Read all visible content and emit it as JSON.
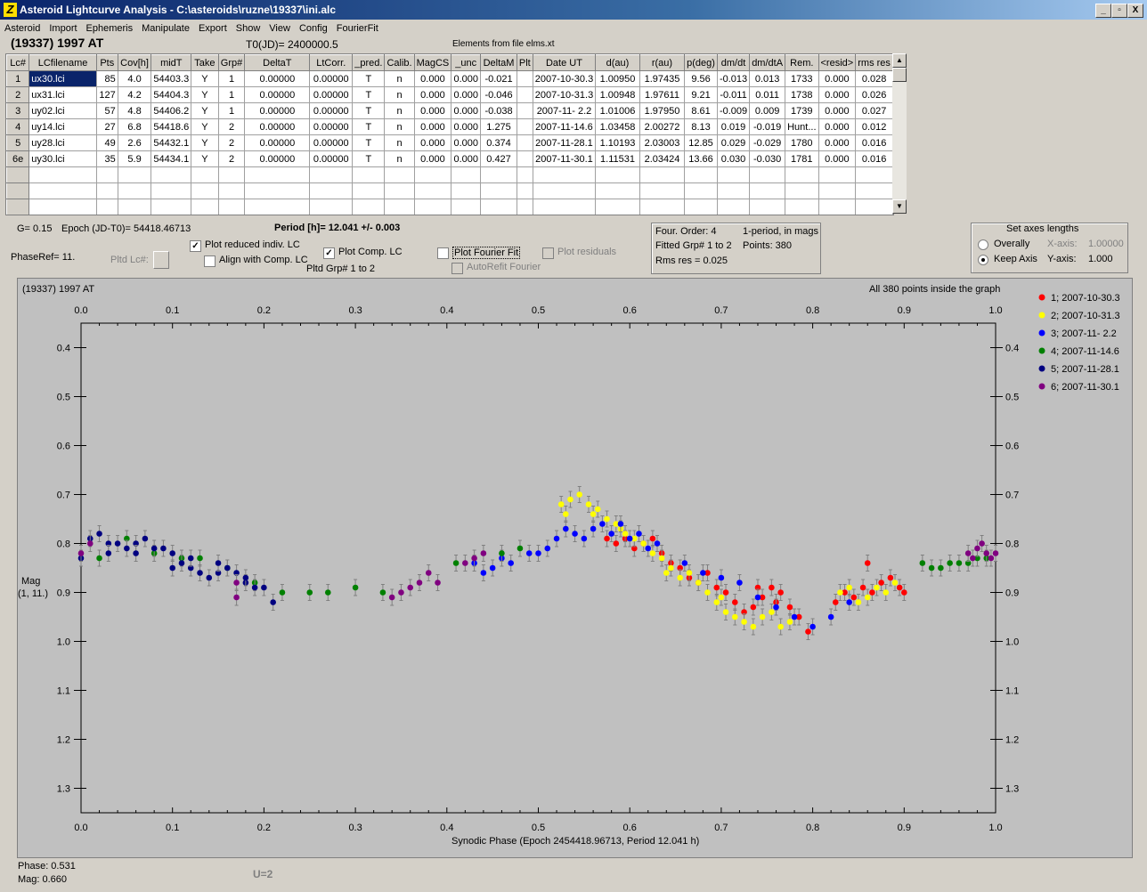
{
  "window": {
    "title": "Asteroid Lightcurve Analysis - C:\\asteroids\\ruzne\\19337\\ini.alc",
    "buttons": [
      "_",
      "▫",
      "X"
    ]
  },
  "menu": [
    "Asteroid",
    "Import",
    "Ephemeris",
    "Manipulate",
    "Export",
    "Show",
    "View",
    "Config",
    "FourierFit"
  ],
  "header": {
    "asteroid": "(19337) 1997 AT",
    "t0": "T0(JD)= 2400000.5",
    "elements": "Elements from file elms.xt"
  },
  "table": {
    "columns": [
      "Lc#",
      "LCfilename",
      "Pts",
      "Cov[h]",
      "midT",
      "Take",
      "Grp#",
      "DeltaT",
      "LtCorr.",
      "_pred.",
      "Calib.",
      "MagCS",
      "_unc",
      "DeltaM",
      "Plt",
      "Date UT",
      "d(au)",
      "r(au)",
      "p(deg)",
      "dm/dt",
      "dm/dtA",
      "Rem.",
      "<resid>",
      "rms res"
    ],
    "rows": [
      [
        "1",
        "ux30.lci",
        "85",
        "4.0",
        "54403.3",
        "Y",
        "1",
        "0.00000",
        "0.00000",
        "T",
        "n",
        "0.000",
        "0.000",
        "-0.021",
        "",
        "2007-10-30.3",
        "1.00950",
        "1.97435",
        "9.56",
        "-0.013",
        "0.013",
        "1733",
        "0.000",
        "0.028"
      ],
      [
        "2",
        "ux31.lci",
        "127",
        "4.2",
        "54404.3",
        "Y",
        "1",
        "0.00000",
        "0.00000",
        "T",
        "n",
        "0.000",
        "0.000",
        "-0.046",
        "",
        "2007-10-31.3",
        "1.00948",
        "1.97611",
        "9.21",
        "-0.011",
        "0.011",
        "1738",
        "0.000",
        "0.026"
      ],
      [
        "3",
        "uy02.lci",
        "57",
        "4.8",
        "54406.2",
        "Y",
        "1",
        "0.00000",
        "0.00000",
        "T",
        "n",
        "0.000",
        "0.000",
        "-0.038",
        "",
        "2007-11- 2.2",
        "1.01006",
        "1.97950",
        "8.61",
        "-0.009",
        "0.009",
        "1739",
        "0.000",
        "0.027"
      ],
      [
        "4",
        "uy14.lci",
        "27",
        "6.8",
        "54418.6",
        "Y",
        "2",
        "0.00000",
        "0.00000",
        "T",
        "n",
        "0.000",
        "0.000",
        "1.275",
        "",
        "2007-11-14.6",
        "1.03458",
        "2.00272",
        "8.13",
        "0.019",
        "-0.019",
        "Hunt...",
        "0.000",
        "0.012"
      ],
      [
        "5",
        "uy28.lci",
        "49",
        "2.6",
        "54432.1",
        "Y",
        "2",
        "0.00000",
        "0.00000",
        "T",
        "n",
        "0.000",
        "0.000",
        "0.374",
        "",
        "2007-11-28.1",
        "1.10193",
        "2.03003",
        "12.85",
        "0.029",
        "-0.029",
        "1780",
        "0.000",
        "0.016"
      ],
      [
        "6e",
        "uy30.lci",
        "35",
        "5.9",
        "54434.1",
        "Y",
        "2",
        "0.00000",
        "0.00000",
        "T",
        "n",
        "0.000",
        "0.000",
        "0.427",
        "",
        "2007-11-30.1",
        "1.11531",
        "2.03424",
        "13.66",
        "0.030",
        "-0.030",
        "1781",
        "0.000",
        "0.016"
      ]
    ],
    "empty_rows": 3
  },
  "params": {
    "g": "G= 0.15",
    "epoch": "Epoch (JD-T0)= 54418.46713",
    "period": "Period [h]= 12.041 +/- 0.003",
    "phaseref": "PhaseRef= 11.",
    "pltd_lc": "Pltd Lc#:",
    "plot_reduced": "Plot reduced indiv. LC",
    "align_comp": "Align with Comp. LC",
    "plot_comp": "Plot Comp. LC",
    "pltd_grp": "Pltd Grp#  1   to   2",
    "plot_fourier": "Plot Fourier Fit",
    "autorefit": "AutoRefit Fourier",
    "plot_residuals": "Plot residuals"
  },
  "fourier_info": {
    "order": "Four. Order:  4",
    "mode": "1-period, in mags",
    "fitted": "Fitted Grp# 1 to 2",
    "points": "Points: 380",
    "rms": "Rms res     = 0.025"
  },
  "axes_box": {
    "title": "Set axes lengths",
    "overally": "Overally",
    "keep_axis": "Keep Axis",
    "xaxis_label": "X-axis:",
    "xaxis_value": "1.00000",
    "yaxis_label": "Y-axis:",
    "yaxis_value": "1.000"
  },
  "graph": {
    "top_left": "(19337) 1997 AT",
    "top_right": "All 380 points inside the graph",
    "ylabel_line1": "Mag",
    "ylabel_line2": "(1, 11.)",
    "xlabel": "Synodic Phase (Epoch 2454418.96713, Period 12.041 h)"
  },
  "status": {
    "phase": "Phase:  0.531",
    "mag": "Mag:    0.660",
    "u": "U=2"
  },
  "chart_data": {
    "type": "scatter",
    "xlabel": "Synodic Phase (Epoch 2454418.96713, Period 12.041 h)",
    "ylabel": "Mag (1, 11.)",
    "xlim": [
      0,
      1
    ],
    "ylim": [
      1.35,
      0.35
    ],
    "y_inverted": true,
    "xticks": [
      "0.0",
      "0.1",
      "0.2",
      "0.3",
      "0.4",
      "0.5",
      "0.6",
      "0.7",
      "0.8",
      "0.9",
      "1.0"
    ],
    "yticks": [
      "0.4",
      "0.5",
      "0.6",
      "0.7",
      "0.8",
      "0.9",
      "1.0",
      "1.1",
      "1.2",
      "1.3"
    ],
    "legend_position": "right",
    "series": [
      {
        "name": "1; 2007-10-30.3",
        "color": "#ff0000",
        "points": [
          [
            0.575,
            0.79
          ],
          [
            0.585,
            0.8
          ],
          [
            0.595,
            0.79
          ],
          [
            0.605,
            0.81
          ],
          [
            0.615,
            0.8
          ],
          [
            0.625,
            0.79
          ],
          [
            0.635,
            0.82
          ],
          [
            0.645,
            0.84
          ],
          [
            0.655,
            0.85
          ],
          [
            0.665,
            0.87
          ],
          [
            0.675,
            0.88
          ],
          [
            0.685,
            0.86
          ],
          [
            0.695,
            0.89
          ],
          [
            0.705,
            0.9
          ],
          [
            0.715,
            0.92
          ],
          [
            0.725,
            0.94
          ],
          [
            0.735,
            0.93
          ],
          [
            0.745,
            0.91
          ],
          [
            0.755,
            0.89
          ],
          [
            0.765,
            0.9
          ],
          [
            0.775,
            0.93
          ],
          [
            0.785,
            0.95
          ],
          [
            0.795,
            0.98
          ],
          [
            0.825,
            0.92
          ],
          [
            0.835,
            0.9
          ],
          [
            0.845,
            0.91
          ],
          [
            0.855,
            0.89
          ],
          [
            0.865,
            0.9
          ],
          [
            0.875,
            0.88
          ],
          [
            0.885,
            0.87
          ],
          [
            0.895,
            0.89
          ],
          [
            0.9,
            0.9
          ],
          [
            0.86,
            0.84
          ],
          [
            0.74,
            0.89
          ],
          [
            0.76,
            0.92
          ]
        ]
      },
      {
        "name": "2; 2007-10-31.3",
        "color": "#ffff00",
        "points": [
          [
            0.525,
            0.72
          ],
          [
            0.535,
            0.71
          ],
          [
            0.545,
            0.7
          ],
          [
            0.555,
            0.72
          ],
          [
            0.565,
            0.73
          ],
          [
            0.575,
            0.75
          ],
          [
            0.585,
            0.76
          ],
          [
            0.595,
            0.78
          ],
          [
            0.605,
            0.79
          ],
          [
            0.615,
            0.8
          ],
          [
            0.625,
            0.82
          ],
          [
            0.635,
            0.83
          ],
          [
            0.645,
            0.85
          ],
          [
            0.655,
            0.87
          ],
          [
            0.665,
            0.86
          ],
          [
            0.675,
            0.88
          ],
          [
            0.685,
            0.9
          ],
          [
            0.695,
            0.92
          ],
          [
            0.705,
            0.94
          ],
          [
            0.715,
            0.95
          ],
          [
            0.725,
            0.96
          ],
          [
            0.735,
            0.97
          ],
          [
            0.745,
            0.95
          ],
          [
            0.755,
            0.94
          ],
          [
            0.765,
            0.97
          ],
          [
            0.775,
            0.96
          ],
          [
            0.83,
            0.9
          ],
          [
            0.84,
            0.89
          ],
          [
            0.85,
            0.92
          ],
          [
            0.86,
            0.91
          ],
          [
            0.87,
            0.89
          ],
          [
            0.88,
            0.9
          ],
          [
            0.89,
            0.88
          ],
          [
            0.53,
            0.74
          ],
          [
            0.56,
            0.74
          ],
          [
            0.59,
            0.77
          ],
          [
            0.64,
            0.86
          ],
          [
            0.7,
            0.91
          ]
        ]
      },
      {
        "name": "3; 2007-11- 2.2",
        "color": "#0000ff",
        "points": [
          [
            0.44,
            0.86
          ],
          [
            0.45,
            0.85
          ],
          [
            0.47,
            0.84
          ],
          [
            0.49,
            0.82
          ],
          [
            0.5,
            0.82
          ],
          [
            0.51,
            0.81
          ],
          [
            0.52,
            0.79
          ],
          [
            0.53,
            0.77
          ],
          [
            0.54,
            0.78
          ],
          [
            0.55,
            0.79
          ],
          [
            0.56,
            0.77
          ],
          [
            0.57,
            0.76
          ],
          [
            0.58,
            0.78
          ],
          [
            0.59,
            0.76
          ],
          [
            0.6,
            0.79
          ],
          [
            0.61,
            0.78
          ],
          [
            0.62,
            0.81
          ],
          [
            0.63,
            0.8
          ],
          [
            0.66,
            0.84
          ],
          [
            0.68,
            0.86
          ],
          [
            0.7,
            0.87
          ],
          [
            0.72,
            0.88
          ],
          [
            0.74,
            0.91
          ],
          [
            0.76,
            0.93
          ],
          [
            0.78,
            0.95
          ],
          [
            0.8,
            0.97
          ],
          [
            0.82,
            0.95
          ],
          [
            0.84,
            0.92
          ],
          [
            0.43,
            0.84
          ],
          [
            0.46,
            0.83
          ]
        ]
      },
      {
        "name": "4; 2007-11-14.6",
        "color": "#008000",
        "points": [
          [
            0.02,
            0.83
          ],
          [
            0.05,
            0.79
          ],
          [
            0.08,
            0.82
          ],
          [
            0.11,
            0.83
          ],
          [
            0.13,
            0.83
          ],
          [
            0.16,
            0.85
          ],
          [
            0.19,
            0.88
          ],
          [
            0.22,
            0.9
          ],
          [
            0.25,
            0.9
          ],
          [
            0.27,
            0.9
          ],
          [
            0.3,
            0.89
          ],
          [
            0.33,
            0.9
          ],
          [
            0.41,
            0.84
          ],
          [
            0.46,
            0.82
          ],
          [
            0.48,
            0.81
          ],
          [
            0.92,
            0.84
          ],
          [
            0.93,
            0.85
          ],
          [
            0.94,
            0.85
          ],
          [
            0.95,
            0.84
          ],
          [
            0.96,
            0.84
          ],
          [
            0.97,
            0.84
          ],
          [
            0.98,
            0.83
          ],
          [
            0.99,
            0.83
          ]
        ]
      },
      {
        "name": "5; 2007-11-28.1",
        "color": "#000080",
        "points": [
          [
            0.0,
            0.83
          ],
          [
            0.01,
            0.79
          ],
          [
            0.02,
            0.78
          ],
          [
            0.03,
            0.8
          ],
          [
            0.04,
            0.8
          ],
          [
            0.05,
            0.81
          ],
          [
            0.06,
            0.8
          ],
          [
            0.07,
            0.79
          ],
          [
            0.08,
            0.81
          ],
          [
            0.09,
            0.81
          ],
          [
            0.1,
            0.82
          ],
          [
            0.1,
            0.85
          ],
          [
            0.11,
            0.84
          ],
          [
            0.12,
            0.85
          ],
          [
            0.13,
            0.86
          ],
          [
            0.14,
            0.87
          ],
          [
            0.15,
            0.86
          ],
          [
            0.16,
            0.85
          ],
          [
            0.17,
            0.86
          ],
          [
            0.18,
            0.88
          ],
          [
            0.19,
            0.89
          ],
          [
            0.2,
            0.89
          ],
          [
            0.21,
            0.92
          ],
          [
            0.03,
            0.82
          ],
          [
            0.06,
            0.82
          ],
          [
            0.12,
            0.83
          ],
          [
            0.15,
            0.84
          ],
          [
            0.18,
            0.87
          ]
        ]
      },
      {
        "name": "6; 2007-11-30.1",
        "color": "#800080",
        "points": [
          [
            0.0,
            0.82
          ],
          [
            0.01,
            0.8
          ],
          [
            0.17,
            0.88
          ],
          [
            0.17,
            0.91
          ],
          [
            0.34,
            0.91
          ],
          [
            0.36,
            0.89
          ],
          [
            0.37,
            0.88
          ],
          [
            0.38,
            0.86
          ],
          [
            0.39,
            0.88
          ],
          [
            0.42,
            0.84
          ],
          [
            0.43,
            0.83
          ],
          [
            0.44,
            0.82
          ],
          [
            0.97,
            0.82
          ],
          [
            0.98,
            0.81
          ],
          [
            0.99,
            0.82
          ],
          [
            1.0,
            0.82
          ],
          [
            0.985,
            0.8
          ],
          [
            0.995,
            0.83
          ],
          [
            0.975,
            0.83
          ],
          [
            0.35,
            0.9
          ]
        ]
      }
    ]
  }
}
